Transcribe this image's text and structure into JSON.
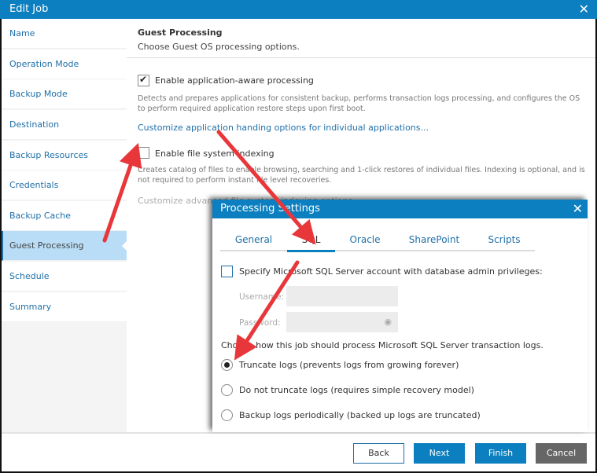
{
  "window": {
    "title": "Edit Job",
    "close_icon": "close-icon"
  },
  "sidebar": {
    "items": [
      {
        "label": "Name"
      },
      {
        "label": "Operation Mode"
      },
      {
        "label": "Backup Mode"
      },
      {
        "label": "Destination"
      },
      {
        "label": "Backup Resources"
      },
      {
        "label": "Credentials"
      },
      {
        "label": "Backup Cache"
      },
      {
        "label": "Guest Processing",
        "active": true
      },
      {
        "label": "Schedule"
      },
      {
        "label": "Summary"
      }
    ]
  },
  "main": {
    "title": "Guest Processing",
    "subtitle": "Choose Guest OS processing options.",
    "app_aware": {
      "label": "Enable application-aware processing",
      "checked": true,
      "description": "Detects and prepares applications for consistent backup, performs transaction logs processing, and configures the OS to perform required application restore steps upon first boot.",
      "link": "Customize application handing options for individual applications..."
    },
    "indexing": {
      "label": "Enable file system indexing",
      "checked": false,
      "description": "Creates catalog of files to enable browsing, searching and 1-click restores of individual files. Indexing is optional, and is not required to perform instant file level recoveries.",
      "link": "Customize advanced file system indexing options..."
    }
  },
  "footer": {
    "back": "Back",
    "next": "Next",
    "finish": "Finish",
    "cancel": "Cancel"
  },
  "modal": {
    "title": "Processing Settings",
    "tabs": [
      {
        "label": "General"
      },
      {
        "label": "SQL",
        "active": true
      },
      {
        "label": "Oracle"
      },
      {
        "label": "SharePoint"
      },
      {
        "label": "Scripts"
      }
    ],
    "sql_account": {
      "label": "Specify Microsoft SQL Server account with database admin privileges:",
      "checked": false
    },
    "username_label": "Username:",
    "username_value": "",
    "password_label": "Password:",
    "password_value": "",
    "logs_prompt": "Choose how this job should process Microsoft SQL Server transaction logs.",
    "log_options": [
      {
        "label": "Truncate logs (prevents logs from growing forever)",
        "selected": true
      },
      {
        "label": "Do not truncate logs (requires simple recovery model)",
        "selected": false
      },
      {
        "label": "Backup logs periodically (backed up logs are truncated)",
        "selected": false
      }
    ]
  },
  "annotations": {
    "arrow_color": "#e8373a"
  }
}
